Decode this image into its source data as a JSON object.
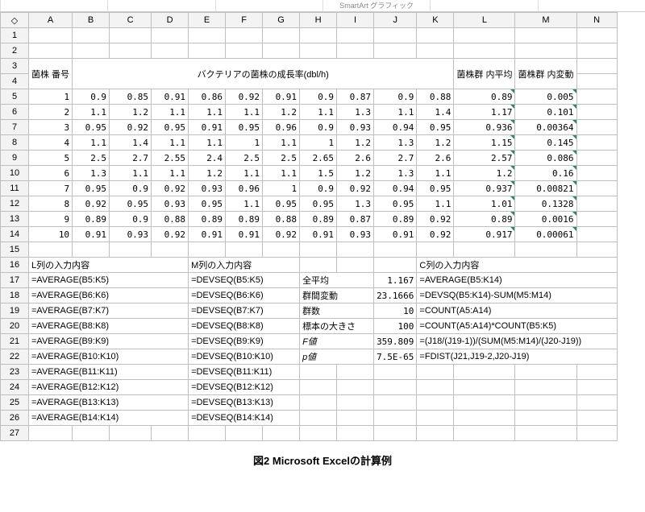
{
  "ribbon": [
    "",
    "",
    "",
    "SmartArt グラフィック",
    "",
    ""
  ],
  "colHeaders": [
    "◇",
    "A",
    "B",
    "C",
    "D",
    "E",
    "F",
    "G",
    "H",
    "I",
    "J",
    "K",
    "L",
    "M",
    "N"
  ],
  "rowNums": [
    "1",
    "2",
    "3",
    "4",
    "5",
    "6",
    "7",
    "8",
    "9",
    "10",
    "11",
    "12",
    "13",
    "14",
    "15",
    "16",
    "17",
    "18",
    "19",
    "20",
    "21",
    "22",
    "23",
    "24",
    "25",
    "26",
    "27"
  ],
  "hdr": {
    "strain": "菌株\n番号",
    "growth": "バクテリアの菌株の成長率(dbl/h)",
    "mean": "菌株群\n内平均",
    "var": "菌株群\n内変動"
  },
  "data": [
    {
      "id": "1",
      "v": [
        "0.9",
        "0.85",
        "0.91",
        "0.86",
        "0.92",
        "0.91",
        "0.9",
        "0.87",
        "0.9",
        "0.88"
      ],
      "mean": "0.89",
      "var": "0.005"
    },
    {
      "id": "2",
      "v": [
        "1.1",
        "1.2",
        "1.1",
        "1.1",
        "1.1",
        "1.2",
        "1.1",
        "1.3",
        "1.1",
        "1.4"
      ],
      "mean": "1.17",
      "var": "0.101"
    },
    {
      "id": "3",
      "v": [
        "0.95",
        "0.92",
        "0.95",
        "0.91",
        "0.95",
        "0.96",
        "0.9",
        "0.93",
        "0.94",
        "0.95"
      ],
      "mean": "0.936",
      "var": "0.00364"
    },
    {
      "id": "4",
      "v": [
        "1.1",
        "1.4",
        "1.1",
        "1.1",
        "1",
        "1.1",
        "1",
        "1.2",
        "1.3",
        "1.2"
      ],
      "mean": "1.15",
      "var": "0.145"
    },
    {
      "id": "5",
      "v": [
        "2.5",
        "2.7",
        "2.55",
        "2.4",
        "2.5",
        "2.5",
        "2.65",
        "2.6",
        "2.7",
        "2.6"
      ],
      "mean": "2.57",
      "var": "0.086"
    },
    {
      "id": "6",
      "v": [
        "1.3",
        "1.1",
        "1.1",
        "1.2",
        "1.1",
        "1.1",
        "1.5",
        "1.2",
        "1.3",
        "1.1"
      ],
      "mean": "1.2",
      "var": "0.16"
    },
    {
      "id": "7",
      "v": [
        "0.95",
        "0.9",
        "0.92",
        "0.93",
        "0.96",
        "1",
        "0.9",
        "0.92",
        "0.94",
        "0.95"
      ],
      "mean": "0.937",
      "var": "0.00821"
    },
    {
      "id": "8",
      "v": [
        "0.92",
        "0.95",
        "0.93",
        "0.95",
        "1.1",
        "0.95",
        "0.95",
        "1.3",
        "0.95",
        "1.1"
      ],
      "mean": "1.01",
      "var": "0.1328"
    },
    {
      "id": "9",
      "v": [
        "0.89",
        "0.9",
        "0.88",
        "0.89",
        "0.89",
        "0.88",
        "0.89",
        "0.87",
        "0.89",
        "0.92"
      ],
      "mean": "0.89",
      "var": "0.0016"
    },
    {
      "id": "10",
      "v": [
        "0.91",
        "0.93",
        "0.92",
        "0.91",
        "0.91",
        "0.92",
        "0.91",
        "0.93",
        "0.91",
        "0.92"
      ],
      "mean": "0.917",
      "var": "0.00061"
    }
  ],
  "sectionHdr": {
    "L": "L列の入力内容",
    "M": "M列の入力内容",
    "C": "C列の入力内容"
  },
  "formL": [
    "=AVERAGE(B5:K5)",
    "=AVERAGE(B6:K6)",
    "=AVERAGE(B7:K7)",
    "=AVERAGE(B8:K8)",
    "=AVERAGE(B9:K9)",
    "=AVERAGE(B10:K10)",
    "=AVERAGE(B11:K11)",
    "=AVERAGE(B12:K12)",
    "=AVERAGE(B13:K13)",
    "=AVERAGE(B14:K14)"
  ],
  "formM": [
    "=DEVSEQ(B5:K5)",
    "=DEVSEQ(B6:K6)",
    "=DEVSEQ(B7:K7)",
    "=DEVSEQ(B8:K8)",
    "=DEVSEQ(B9:K9)",
    "=DEVSEQ(B10:K10)",
    "=DEVSEQ(B11:K11)",
    "=DEVSEQ(B12:K12)",
    "=DEVSEQ(B13:K13)",
    "=DEVSEQ(B14:K14)"
  ],
  "stats": [
    {
      "lbl": "全平均",
      "val": "1.167",
      "form": "=AVERAGE(B5:K14)"
    },
    {
      "lbl": "群間変動",
      "val": "23.1666",
      "form": "=DEVSQ(B5:K14)-SUM(M5:M14)"
    },
    {
      "lbl": "群数",
      "val": "10",
      "form": "=COUNT(A5:A14)"
    },
    {
      "lbl": "標本の大きさ",
      "val": "100",
      "form": "=COUNT(A5:A14)*COUNT(B5:K5)"
    },
    {
      "lbl": "F値",
      "val": "359.809",
      "form": "=(J18/(J19-1))/(SUM(M5:M14)/(J20-J19))",
      "ital": true
    },
    {
      "lbl": "p値",
      "val": "7.5E-65",
      "form": "=FDIST(J21,J19-2,J20-J19)",
      "ital": true
    }
  ],
  "caption": "図2  Microsoft Excelの計算例"
}
